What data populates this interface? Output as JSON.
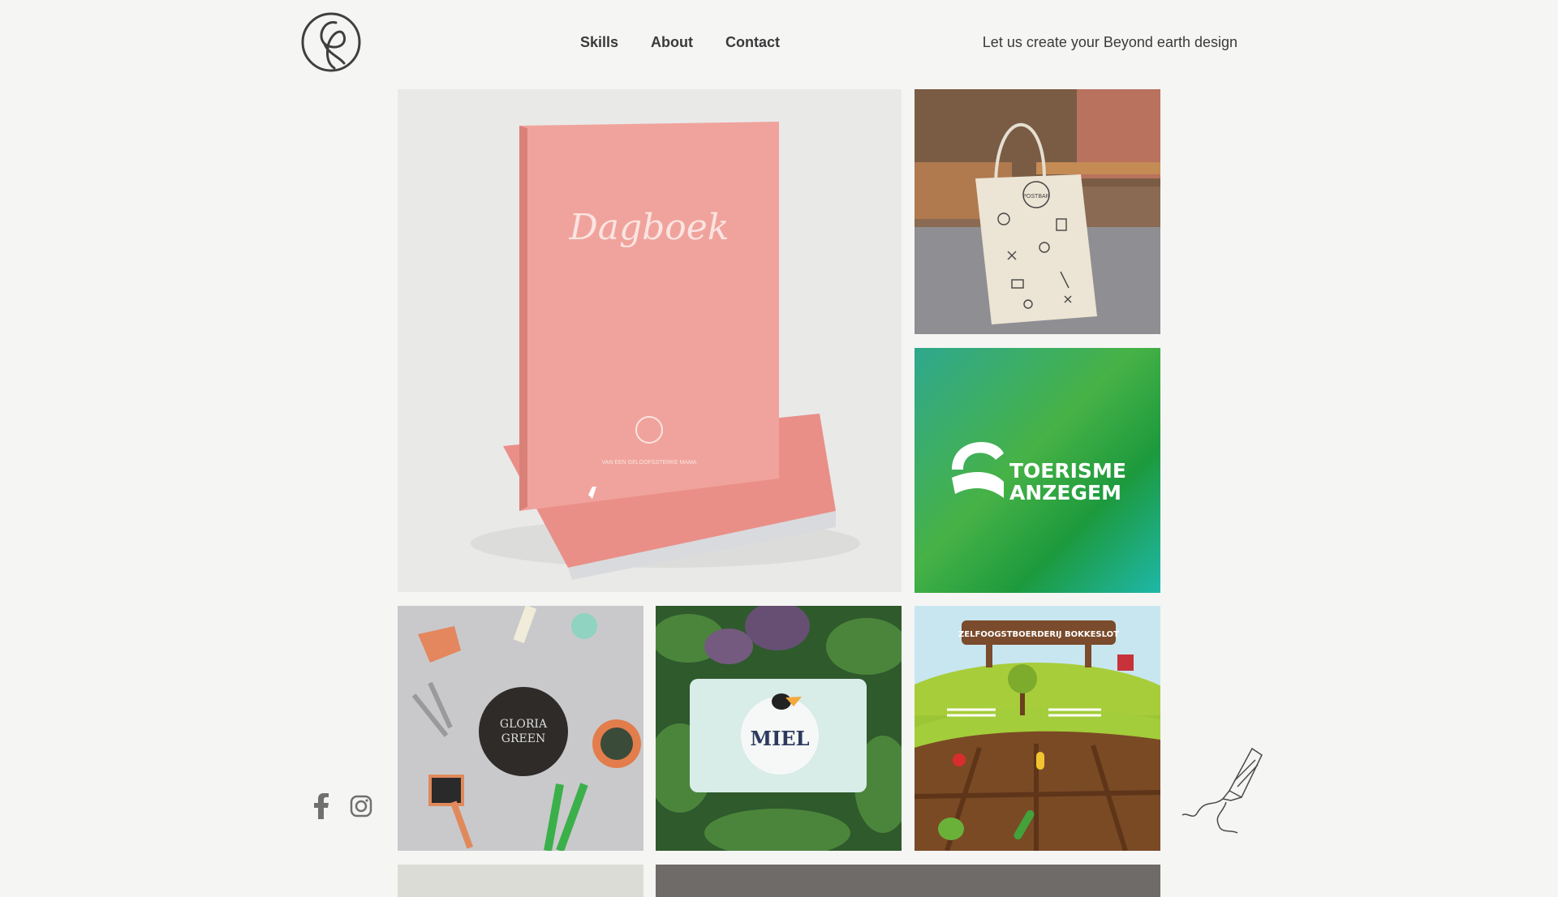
{
  "nav": {
    "items": [
      "Skills",
      "About",
      "Contact"
    ]
  },
  "tagline": "Let us create your Beyond earth design",
  "tiles": {
    "book_title": "Dagboek",
    "book_subtitle": "VAN EEN GELOOFSSTERKE MAMA",
    "tote_badge": "POSTBAR",
    "tourism_line1": "TOERISME",
    "tourism_line2": "ANZEGEM",
    "gloria_line1": "GLORIA",
    "gloria_line2": "GREEN",
    "miel_label": "MIEL",
    "farm_sign": "ZELFOOGSTBOERDERIJ BOKKESLOT"
  },
  "social": {
    "icons": [
      "facebook-icon",
      "instagram-icon"
    ]
  },
  "colors": {
    "background": "#f5f5f4",
    "text": "#3a3a3a",
    "book_pink": "#ef9f98",
    "tourism_green_top": "#2aa58c",
    "tourism_green_mid": "#3fb04a",
    "farm_sky": "#c8e6ef"
  }
}
